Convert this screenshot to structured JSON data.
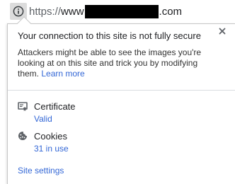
{
  "address_bar": {
    "icon": "info-icon",
    "url_scheme": "https://",
    "url_host_prefix": "www",
    "url_host_suffix": ".com"
  },
  "popup": {
    "title": "Your connection to this site is not fully secure",
    "description": "Attackers might be able to see the images you're looking at on this site and trick you by modifying them.",
    "learn_more": "Learn more",
    "close_icon": "close-icon",
    "certificate": {
      "icon": "certificate-icon",
      "label": "Certificate",
      "value": "Valid"
    },
    "cookies": {
      "icon": "cookie-icon",
      "label": "Cookies",
      "value": "31 in use"
    },
    "site_settings": "Site settings"
  },
  "colors": {
    "link": "#3367d6",
    "text": "#202124",
    "border": "#c7c7c7"
  }
}
